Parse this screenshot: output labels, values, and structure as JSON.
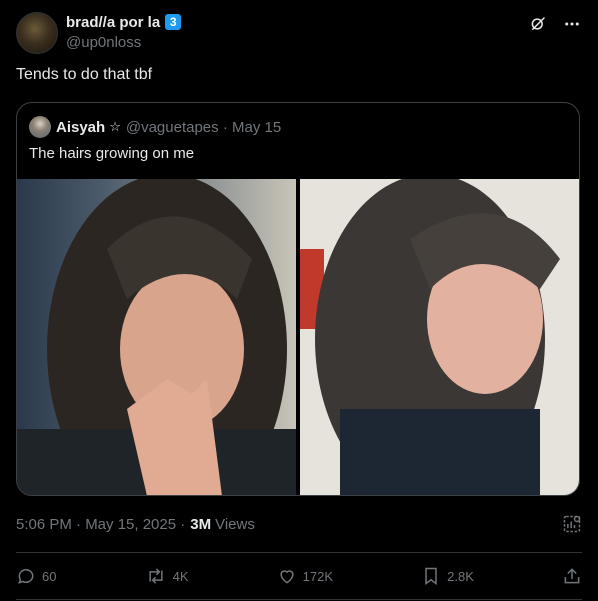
{
  "author": {
    "display_name": "brad//a por la",
    "badge": "3",
    "handle": "@up0nloss"
  },
  "tweet": {
    "text": "Tends to do that tbf"
  },
  "quote": {
    "display_name": "Aisyah",
    "star": "☆",
    "handle_date": "@vaguetapes · May 15",
    "text": "The hairs growing on me"
  },
  "meta": {
    "timestamp": "5:06 PM · May 15, 2025 ·",
    "views_count": "3M",
    "views_label": "Views"
  },
  "actions": {
    "replies": "60",
    "reposts": "4K",
    "likes": "172K",
    "bookmarks": "2.8K"
  },
  "icons": {
    "grok": "grok-icon",
    "more": "more-icon",
    "analytics": "analytics-icon",
    "reply": "reply-icon",
    "repost": "repost-icon",
    "like": "heart-icon",
    "bookmark": "bookmark-icon",
    "share": "share-icon"
  },
  "colors": {
    "accent": "#1d9bf0",
    "muted": "#71767b",
    "text": "#e7e9ea",
    "background": "#000000"
  }
}
